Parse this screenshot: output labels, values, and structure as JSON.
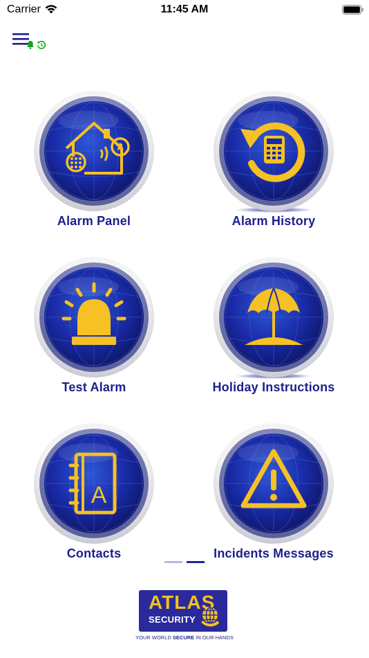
{
  "status_bar": {
    "carrier": "Carrier",
    "time": "11:45 AM",
    "wifi_icon": "wifi-icon",
    "battery_icon": "battery-full-icon"
  },
  "toolbar": {
    "menu_icon": "hamburger-menu-icon",
    "notification_icon": "bell-icon",
    "history_icon": "history-clock-icon",
    "accent_color": "#1c1f8c",
    "indicator_color": "#1aa31a"
  },
  "tiles": [
    {
      "label": "Alarm Panel",
      "icon": "house-keypad-icon"
    },
    {
      "label": "Alarm History",
      "icon": "history-keypad-icon"
    },
    {
      "label": "Test Alarm",
      "icon": "siren-icon"
    },
    {
      "label": "Holiday Instructions",
      "icon": "beach-umbrella-icon"
    },
    {
      "label": "Contacts",
      "icon": "address-book-icon"
    },
    {
      "label": "Incidents Messages",
      "icon": "warning-triangle-icon"
    }
  ],
  "pager": {
    "pages": 2,
    "current_page": 2
  },
  "logo": {
    "brand_top": "ATLAS",
    "brand_bottom": "SECURITY",
    "tagline_pre": "YOUR WORLD ",
    "tagline_bold": "SECURE",
    "tagline_post": " IN OUR HANDS",
    "brand_color": "#2a2a9c",
    "accent_color": "#f3c21b"
  },
  "colors": {
    "orb_blue": "#1a2ba8",
    "icon_gold": "#f5c125",
    "label_navy": "#1c1f8c"
  }
}
